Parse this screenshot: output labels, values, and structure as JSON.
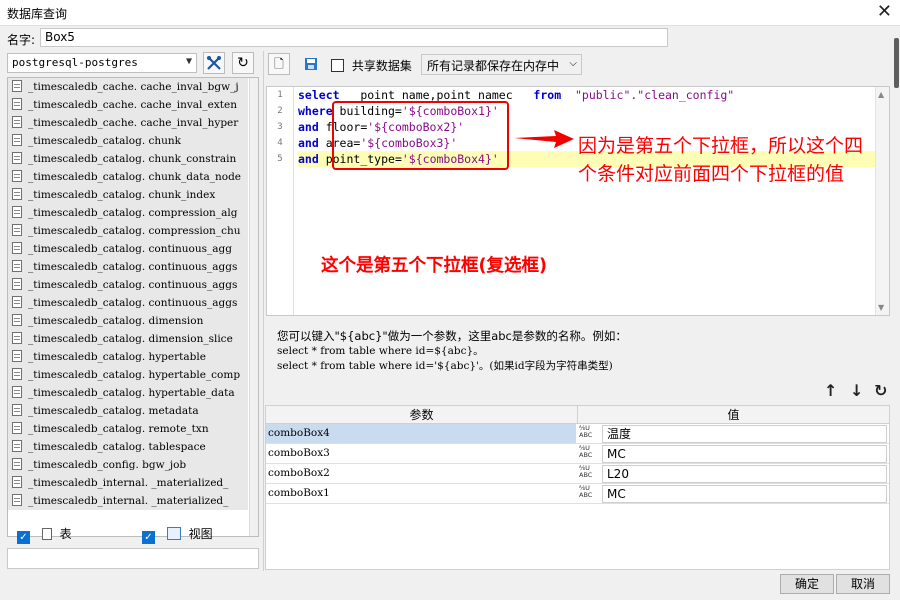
{
  "window": {
    "title": "数据库查询",
    "close_glyph": "✕"
  },
  "name_field": {
    "label": "名字:",
    "value": "Box5"
  },
  "left_panel": {
    "connection": "postgresql-postgres",
    "tables": [
      "_timescaledb_cache. cache_inval_bgw_j",
      "_timescaledb_cache. cache_inval_exten",
      "_timescaledb_cache. cache_inval_hyper",
      "_timescaledb_catalog. chunk",
      "_timescaledb_catalog. chunk_constrain",
      "_timescaledb_catalog. chunk_data_node",
      "_timescaledb_catalog. chunk_index",
      "_timescaledb_catalog. compression_alg",
      "_timescaledb_catalog. compression_chu",
      "_timescaledb_catalog. continuous_agg",
      "_timescaledb_catalog. continuous_aggs",
      "_timescaledb_catalog. continuous_aggs",
      "_timescaledb_catalog. continuous_aggs",
      "_timescaledb_catalog. dimension",
      "_timescaledb_catalog. dimension_slice",
      "_timescaledb_catalog. hypertable",
      "_timescaledb_catalog. hypertable_comp",
      "_timescaledb_catalog. hypertable_data",
      "_timescaledb_catalog. metadata",
      "_timescaledb_catalog. remote_txn",
      "_timescaledb_catalog. tablespace",
      "_timescaledb_config. bgw_job",
      "_timescaledb_internal. _materialized_",
      "_timescaledb_internal. _materialized_"
    ],
    "show_tables_label": "表",
    "show_views_label": "视图"
  },
  "toolbar": {
    "share_dataset_label": "共享数据集",
    "storage_mode": "所有记录都保存在内存中"
  },
  "sql": {
    "line_numbers": [
      "1",
      "2",
      "3",
      "4",
      "5"
    ],
    "lines": [
      [
        {
          "t": "select",
          "c": "kw"
        },
        {
          "t": "   point_name,point_namec   ",
          "c": ""
        },
        {
          "t": "from",
          "c": "kw"
        },
        {
          "t": "  ",
          "c": ""
        },
        {
          "t": "\"public\".\"clean_config\"",
          "c": "str"
        }
      ],
      [
        {
          "t": "where",
          "c": "kw"
        },
        {
          "t": " building=",
          "c": ""
        },
        {
          "t": "'${comboBox1}'",
          "c": "str"
        }
      ],
      [
        {
          "t": "and",
          "c": "kw"
        },
        {
          "t": " floor=",
          "c": ""
        },
        {
          "t": "'${comboBox2}'",
          "c": "str"
        }
      ],
      [
        {
          "t": "and",
          "c": "kw"
        },
        {
          "t": " area=",
          "c": ""
        },
        {
          "t": "'${comboBox3}'",
          "c": "str"
        }
      ],
      [
        {
          "t": "and",
          "c": "kw"
        },
        {
          "t": " point_type=",
          "c": ""
        },
        {
          "t": "'${comboBox4}'",
          "c": "str"
        }
      ]
    ]
  },
  "annotations": {
    "note_1": "因为是第五个下拉框，所以这个四个条件对应前面四个下拉框的值",
    "note_2": "这个是第五个下拉框(复选框)"
  },
  "help": {
    "line1": "您可以键入\"${abc}\"做为一个参数，这里abc是参数的名称。例如：",
    "line2": "select * from table where id=${abc}。",
    "line3": "select * from table where id='${abc}'。(如果id字段为字符串类型)"
  },
  "params": {
    "col_param": "参数",
    "col_value": "值",
    "type_icon_text": "⅍U ABC",
    "rows": [
      {
        "name": "comboBox4",
        "value": "温度"
      },
      {
        "name": "comboBox3",
        "value": "MC"
      },
      {
        "name": "comboBox2",
        "value": "L20"
      },
      {
        "name": "comboBox1",
        "value": "MC"
      }
    ]
  },
  "buttons": {
    "ok": "确定",
    "cancel": "取消"
  },
  "colors": {
    "accent": "#0a71d3",
    "annotation": "#ff0000",
    "keyword": "#0000d0",
    "string": "#8a0b8a",
    "highlight_line": "#fdfdb6"
  }
}
